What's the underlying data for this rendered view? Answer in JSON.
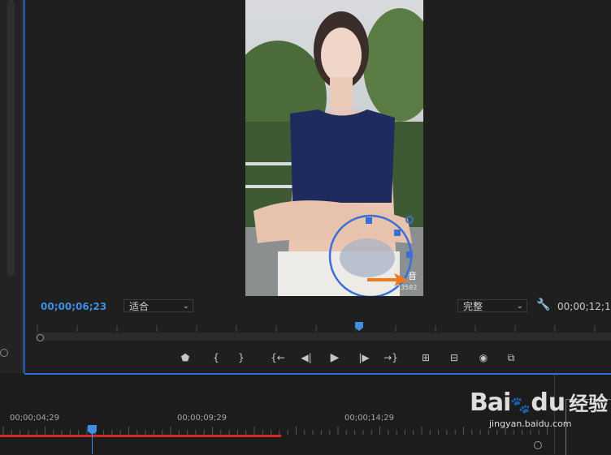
{
  "program_monitor": {
    "current_timecode": "00;00;06;23",
    "end_timecode": "00;00;12;1",
    "fit_select": {
      "value": "适合"
    },
    "quality_select": {
      "value": "完整"
    },
    "overlay_text_top": "音",
    "overlay_text_bottom": "23582"
  },
  "transport": [
    {
      "name": "add-marker",
      "glyph": "⬟"
    },
    {
      "name": "mark-in",
      "glyph": "{"
    },
    {
      "name": "mark-out",
      "glyph": "}"
    },
    {
      "name": "go-to-in",
      "glyph": "{←"
    },
    {
      "name": "step-back",
      "glyph": "◀|"
    },
    {
      "name": "play",
      "glyph": "▶"
    },
    {
      "name": "step-forward",
      "glyph": "|▶"
    },
    {
      "name": "go-to-out",
      "glyph": "→}"
    },
    {
      "name": "lift",
      "glyph": "⊞"
    },
    {
      "name": "extract",
      "glyph": "⊟"
    },
    {
      "name": "export-frame",
      "glyph": "◉"
    },
    {
      "name": "compare",
      "glyph": "⧉"
    }
  ],
  "timeline": {
    "labels": [
      "00;00;04;29",
      "00;00;09;29",
      "00;00;14;29"
    ]
  },
  "watermark": {
    "brand": "Bai",
    "brand_tail": "du",
    "jingyan": "经验",
    "url": "jingyan.baidu.com"
  },
  "colors": {
    "accent_blue": "#3d8fe0",
    "panel_border": "#2d6fd4",
    "playhead_red": "#d12b2b",
    "arrow_orange": "#f07a1a"
  }
}
